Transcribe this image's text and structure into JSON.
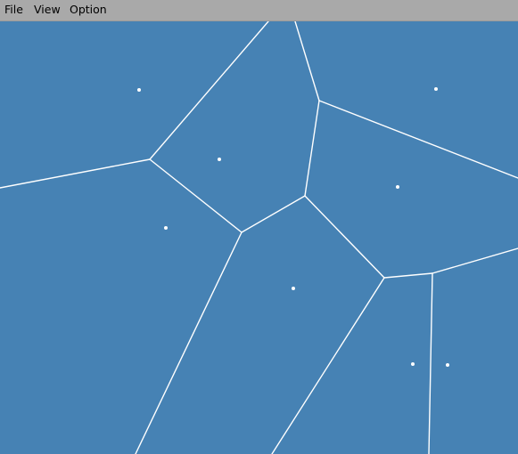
{
  "menu": {
    "file": "File",
    "view": "View",
    "option": "Option"
  },
  "canvas": {
    "background_color": "#4682b4",
    "edge_color": "#ffffff",
    "site_color": "#ffffff"
  }
}
